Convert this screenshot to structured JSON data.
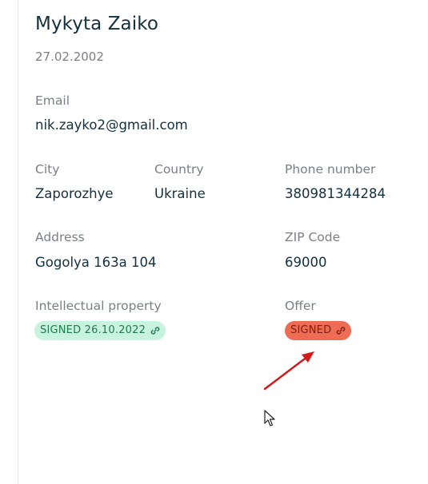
{
  "profile": {
    "name": "Mykyta Zaiko",
    "birth_date": "27.02.2002"
  },
  "fields": {
    "email": {
      "label": "Email",
      "value": "nik.zayko2@gmail.com"
    },
    "city": {
      "label": "City",
      "value": "Zaporozhye"
    },
    "country": {
      "label": "Country",
      "value": "Ukraine"
    },
    "phone": {
      "label": "Phone number",
      "value": "380981344284"
    },
    "address": {
      "label": "Address",
      "value": "Gogolya 163a 104"
    },
    "zip": {
      "label": "ZIP Code",
      "value": "69000"
    }
  },
  "documents": {
    "ip": {
      "label": "Intellectual property",
      "status": "SIGNED 26.10.2022",
      "icon": "link-icon",
      "color": "#c8f3de",
      "text_color": "#1f7a4e"
    },
    "offer": {
      "label": "Offer",
      "status": "SIGNED",
      "icon": "link-icon",
      "color": "#ee6b54",
      "text_color": "#7a2112"
    }
  },
  "annotation": {
    "arrow_color": "#d11a1a"
  }
}
